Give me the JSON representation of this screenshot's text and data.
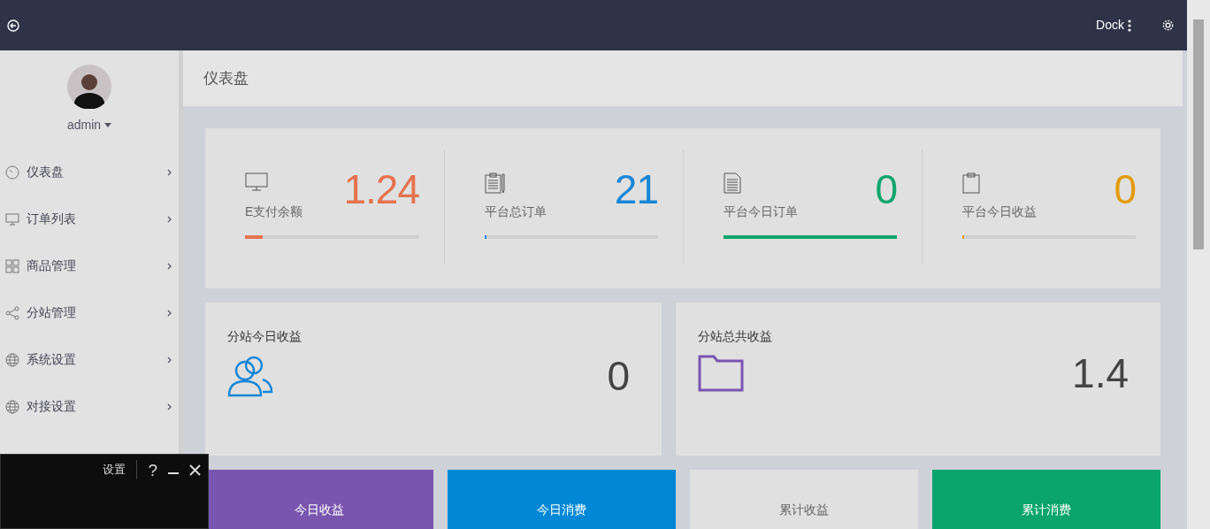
{
  "topbar": {
    "dock_label": "Dock"
  },
  "sidebar": {
    "user": {
      "name": "admin"
    },
    "items": [
      {
        "label": "仪表盘"
      },
      {
        "label": "订单列表"
      },
      {
        "label": "商品管理"
      },
      {
        "label": "分站管理"
      },
      {
        "label": "系统设置"
      },
      {
        "label": "对接设置"
      }
    ]
  },
  "page_title": "仪表盘",
  "stats": [
    {
      "value": "1.24",
      "label": "E支付余额",
      "level": 0.1,
      "color": "#e5734f"
    },
    {
      "value": "21",
      "label": "平台总订单",
      "level": 0.01,
      "color": "#1a87d6"
    },
    {
      "value": "0",
      "label": "平台今日订单",
      "level": 1,
      "color": "#12a56f"
    },
    {
      "value": "0",
      "label": "平台今日收益",
      "level": 0.01,
      "color": "#e39c0f"
    }
  ],
  "summary_cards": [
    {
      "title": "分站今日收益",
      "value": "0"
    },
    {
      "title": "分站总共收益",
      "value": "1.4"
    }
  ],
  "tiles": [
    {
      "label": "今日收益",
      "color": "#7a55b0"
    },
    {
      "label": "今日消费",
      "color": "#0088d6"
    },
    {
      "label": "累计收益",
      "color": "#e0e0e0"
    },
    {
      "label": "累计消费",
      "color": "#0aa56e"
    }
  ],
  "overlay_panel": {
    "settings_label": "设置",
    "help_label": "?"
  }
}
